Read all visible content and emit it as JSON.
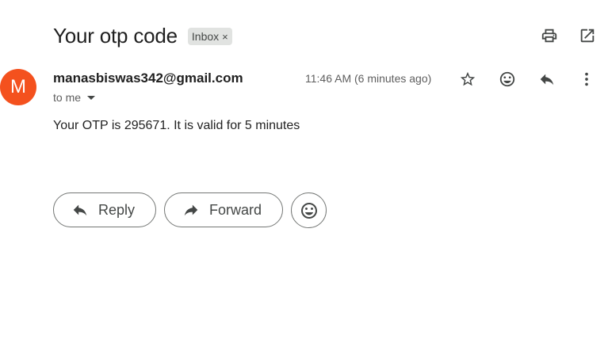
{
  "email": {
    "subject": "Your otp code",
    "label": "Inbox",
    "label_remove": "×",
    "avatar_letter": "M",
    "sender": "manasbiswas342@gmail.com",
    "recipient_summary": "to me",
    "time": "11:46 AM (6 minutes ago)",
    "body": "Your OTP is 295671. It is valid for 5 minutes"
  },
  "actions": {
    "reply_label": "Reply",
    "forward_label": "Forward"
  },
  "colors": {
    "avatar_bg": "#f4511e",
    "label_chip_bg": "#e1e3e1",
    "icon": "#444746"
  },
  "icons": {
    "top": [
      "print-icon",
      "open-in-new-window-icon"
    ],
    "message": [
      "star-icon",
      "emoji-reaction-icon",
      "reply-icon",
      "more-vert-icon"
    ],
    "bottom": [
      "reply-arrow-icon",
      "forward-arrow-icon",
      "emoji-icon"
    ]
  }
}
